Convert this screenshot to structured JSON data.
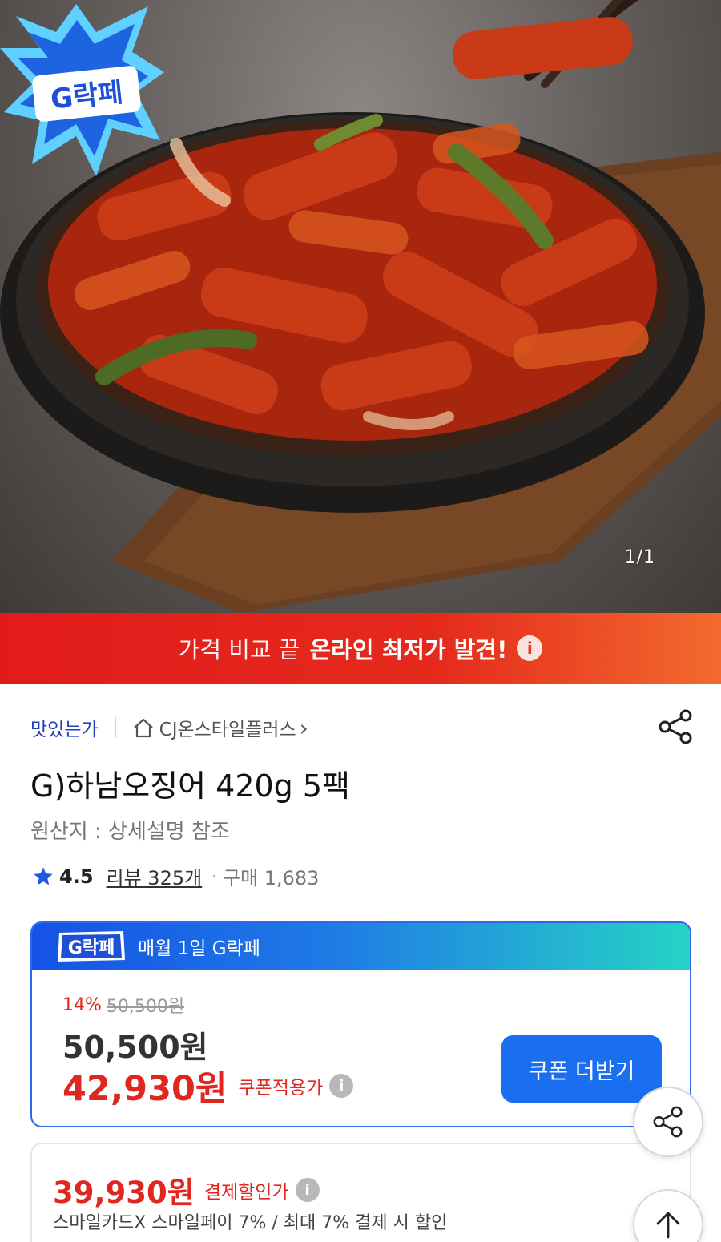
{
  "hero": {
    "page_indicator": "1/1",
    "badge_text": "G락페"
  },
  "promo": {
    "light_text": "가격 비교 끝",
    "strong_text": "온라인 최저가 발견!",
    "info_icon": "i"
  },
  "store": {
    "name": "맛있는가",
    "seller": "CJ온스타일플러스",
    "seller_chevron": "›"
  },
  "product": {
    "title": "G)하남오징어 420g 5팩",
    "origin": "원산지 : 상세설명 참조",
    "rating": "4.5",
    "review": "리뷰 325개",
    "separator": "·",
    "purchase": "구매 1,683"
  },
  "price_card": {
    "header_badge": "G락페",
    "header_text": "매월 1일 G락페",
    "discount_pct": "14%",
    "old_price": "50,500원",
    "sale_price": "50,500원",
    "coupon_price": "42,930원",
    "coupon_label": "쿠폰적용가",
    "info_icon": "i",
    "coupon_button": "쿠폰 더받기"
  },
  "payment": {
    "price": "39,930원",
    "label": "결제할인가",
    "info_icon": "i",
    "description": "스마일카드X 스마일페이 7%  / 최대 7% 결제 시 할인"
  },
  "colors": {
    "brand_red": "#e0261f",
    "brand_blue": "#1a6ff0",
    "store_link": "#1f3fbf"
  }
}
